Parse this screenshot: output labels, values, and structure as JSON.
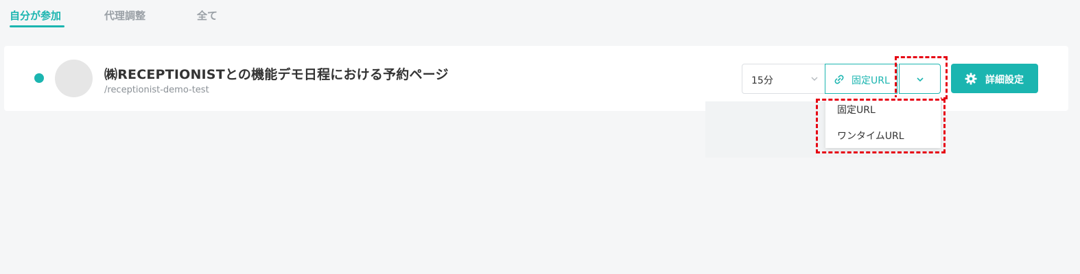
{
  "tabs": [
    {
      "label": "自分が参加",
      "active": true
    },
    {
      "label": "代理調整",
      "active": false
    },
    {
      "label": "全て",
      "active": false
    }
  ],
  "event": {
    "title": "㈱RECEPTIONISTとの機能デモ日程における予約ページ",
    "slug": "/receptionist-demo-test",
    "status_color": "#1bb5b0"
  },
  "controls": {
    "duration_value": "15分",
    "fixed_url_label": "固定URL",
    "details_label": "詳細設定"
  },
  "dropdown_menu": {
    "items": [
      "固定URL",
      "ワンタイムURL"
    ]
  },
  "colors": {
    "accent": "#1bb5b0",
    "highlight": "#e60012"
  },
  "icons": {
    "link": "link-icon",
    "gear": "gear-icon",
    "chevron": "chevron-down-icon"
  }
}
